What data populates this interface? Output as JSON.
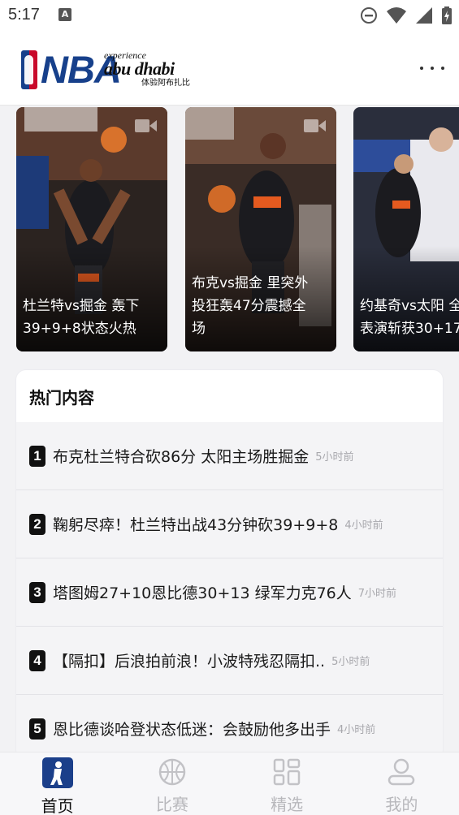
{
  "status_bar": {
    "time": "5:17",
    "notification_letter": "A",
    "icons": [
      "do-not-disturb-icon",
      "wifi-icon",
      "signal-icon",
      "battery-charging-icon"
    ]
  },
  "header": {
    "nba_logo_text": "NBA",
    "sponsor": {
      "line1": "experience",
      "line2": "abu dhabi",
      "line3": "体验阿布扎比"
    },
    "more_icon": "more-horizontal-icon"
  },
  "carousel": {
    "cards": [
      {
        "title": "杜兰特vs掘金 轰下\n39+9+8状态火热",
        "has_video": true,
        "colors": {
          "a": "#3a2a1f",
          "b": "#7a3b1e",
          "c": "#1c1c22"
        }
      },
      {
        "title": "布克vs掘金 里突外\n投狂轰47分震撼全\n场",
        "has_video": true,
        "colors": {
          "a": "#4a3527",
          "b": "#8a4a22",
          "c": "#201b1d"
        }
      },
      {
        "title": "约基奇vs太阳 全\n表演斩获30+17",
        "has_video": false,
        "colors": {
          "a": "#2a3e6b",
          "b": "#d9dbe2",
          "c": "#1b2033"
        }
      }
    ]
  },
  "hot": {
    "title": "热门内容",
    "items": [
      {
        "rank": "1",
        "text": "布克杜兰特合砍86分 太阳主场胜掘金",
        "time": "5小时前"
      },
      {
        "rank": "2",
        "text": "鞠躬尽瘁！杜兰特出战43分钟砍39+9+8",
        "time": "4小时前"
      },
      {
        "rank": "3",
        "text": "塔图姆27+10恩比德30+13 绿军力克76人",
        "time": "7小时前"
      },
      {
        "rank": "4",
        "text": "【隔扣】后浪拍前浪！小波特残忍隔扣..",
        "time": "5小时前"
      },
      {
        "rank": "5",
        "text": "恩比德谈哈登状态低迷：会鼓励他多出手",
        "time": "4小时前"
      }
    ]
  },
  "bottom_nav": {
    "items": [
      {
        "label": "首页",
        "icon": "home-nba-icon",
        "active": true
      },
      {
        "label": "比赛",
        "icon": "basketball-icon",
        "active": false
      },
      {
        "label": "精选",
        "icon": "grid-icon",
        "active": false
      },
      {
        "label": "我的",
        "icon": "user-icon",
        "active": false
      }
    ]
  },
  "colors": {
    "nba_blue": "#17408b",
    "nba_red": "#c9082a",
    "active_nav": "#111111",
    "inactive_nav": "#b8b8bc"
  }
}
